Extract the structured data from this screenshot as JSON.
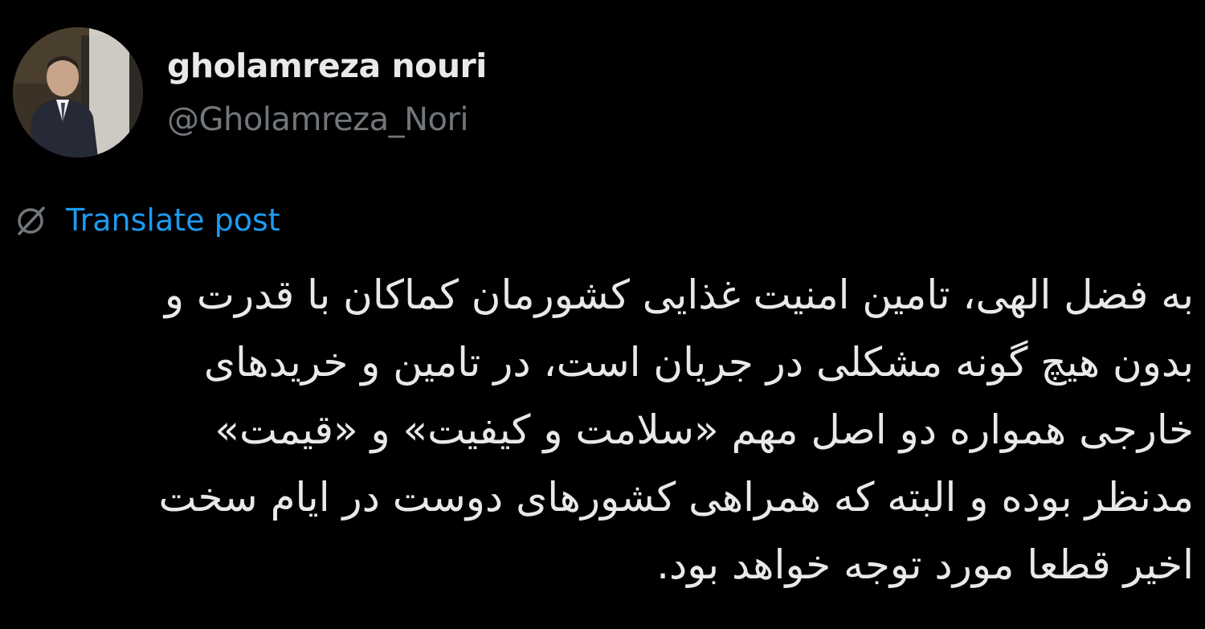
{
  "author": {
    "display_name": "gholamreza nouri",
    "handle": "@Gholamreza_Nori",
    "avatar_icon": "profile-photo"
  },
  "translate": {
    "icon": "translate-globe-icon",
    "label": "Translate post"
  },
  "post": {
    "lines": [
      "به فضل الهی، تامین امنیت غذایی کشورمان کماکان با قدرت و",
      "بدون هیچ گونه مشکلی در جریان است، در تامین و خریدهای",
      "خارجی همواره دو اصل مهم «سلامت و کیفیت» و «قیمت»",
      "مدنظر بوده و البته که همراهی کشورهای دوست در ایام سخت",
      "اخیر قطعا مورد توجه خواهد بود."
    ]
  },
  "colors": {
    "background": "#000000",
    "text_primary": "#e7e9ea",
    "text_secondary": "#71767b",
    "link_blue": "#1d9bf0"
  }
}
